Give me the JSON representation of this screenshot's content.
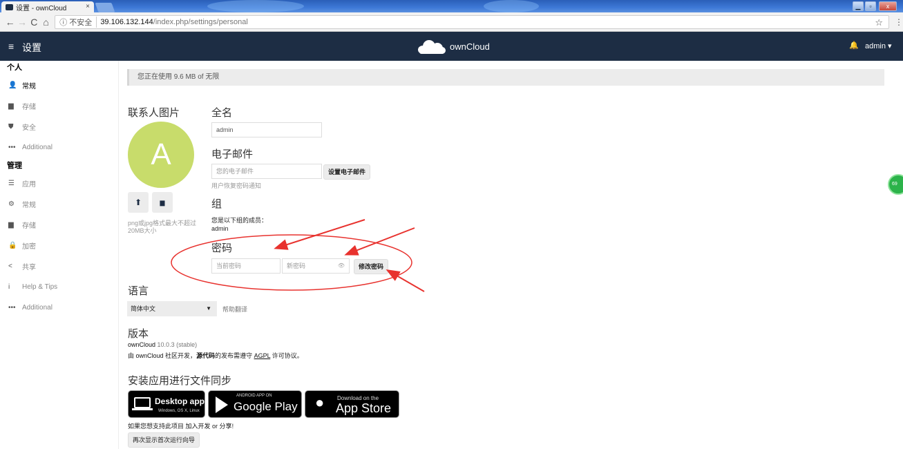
{
  "browser": {
    "tab_title": "设置 - ownCloud",
    "tab_close": "×",
    "security_label": "ⓘ 不安全",
    "url_host": "39.106.132.144",
    "url_path": "/index.php/settings/personal",
    "back": "←",
    "forward": "→",
    "reload": "C",
    "home": "⌂",
    "star": "☆",
    "menu": "⋮"
  },
  "header": {
    "menu_icon": "≡",
    "title": "设置",
    "brand": "ownCloud",
    "user": "admin ▾",
    "bell": "🔔"
  },
  "sidebar": {
    "personal_heading": "个人",
    "personal_items": [
      {
        "icon": "👤",
        "label": "常规",
        "active": true
      },
      {
        "icon": "▆",
        "label": "存储"
      },
      {
        "icon": "⛊",
        "label": "安全"
      },
      {
        "icon": "•••",
        "label": "Additional"
      }
    ],
    "admin_heading": "管理",
    "admin_items": [
      {
        "icon": "☰",
        "label": "应用"
      },
      {
        "icon": "⚙",
        "label": "常规"
      },
      {
        "icon": "▆",
        "label": "存储"
      },
      {
        "icon": "🔒",
        "label": "加密"
      },
      {
        "icon": "<",
        "label": "共享"
      },
      {
        "icon": "i",
        "label": "Help & Tips"
      },
      {
        "icon": "•••",
        "label": "Additional"
      }
    ]
  },
  "usage": "您正在使用 9.6 MB of 无限",
  "profile": {
    "avatar_heading": "联系人图片",
    "avatar_letter": "A",
    "upload_icon": "⬆",
    "folder_icon": "▆",
    "avatar_note_1": "png或jpg格式最大不超过",
    "avatar_note_2": "20MB大小",
    "fullname_heading": "全名",
    "fullname_value": "admin",
    "email_heading": "电子邮件",
    "email_placeholder": "您的电子邮件",
    "email_button": "设置电子邮件",
    "email_note": "用户恢复密码通知",
    "group_heading": "组",
    "group_member_label": "您是以下组的成员：",
    "group_value": "admin",
    "password_heading": "密码",
    "current_password_placeholder": "当前密码",
    "new_password_placeholder": "新密码",
    "eye_icon": "👁",
    "change_password_button": "修改密码"
  },
  "language": {
    "heading": "语言",
    "selected": "简体中文",
    "help_link": "帮助翻译"
  },
  "version": {
    "heading": "版本",
    "product": "ownCloud",
    "number": "10.0.3 (stable)",
    "line2_prefix": "由 ",
    "line2_org": "ownCloud 社区",
    "line2_dev": "开发，",
    "line2_src": "源代码",
    "line2_mid": "的发布需遵守 ",
    "line2_license": "AGPL",
    "line2_suffix": " 许可协议。"
  },
  "sync": {
    "heading": "安装应用进行文件同步",
    "desktop_big": "Desktop app",
    "desktop_small": "Windows, OS X, Linux",
    "android_small": "ANDROID APP ON",
    "android_big": "Google Play",
    "ios_small": "Download on the",
    "ios_big": "App Store",
    "support_prefix": "如果您想支持此项目 ",
    "support_join": "加入开发",
    "support_or": " or ",
    "support_share": "分享",
    "support_end": "!",
    "wizard_button": "再次显示首次运行向导"
  },
  "annotation": {
    "color": "#e8322e"
  }
}
